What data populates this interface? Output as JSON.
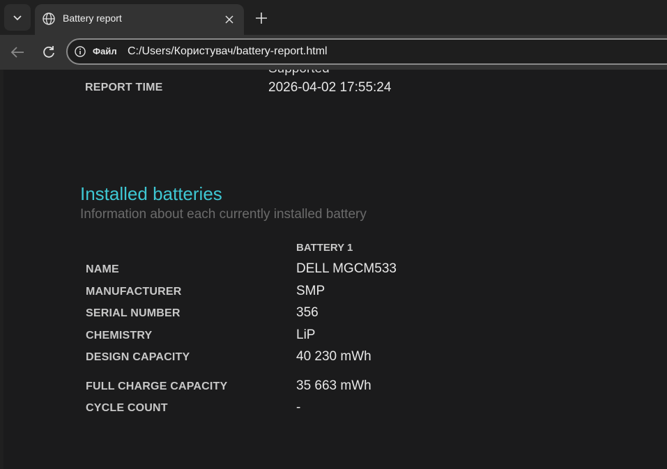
{
  "browser": {
    "tab_title": "Battery report",
    "scheme_label": "Файл",
    "url": "C:/Users/Користувач/battery-report.html"
  },
  "report": {
    "prev_value_cut": "Supported",
    "report_time_label": "REPORT TIME",
    "report_time_value": "2026-04-02  17:55:24"
  },
  "installed": {
    "title": "Installed batteries",
    "subtitle": "Information about each currently installed battery",
    "column_header": "BATTERY 1",
    "rows": [
      {
        "label": "NAME",
        "value": "DELL MGCM533"
      },
      {
        "label": "MANUFACTURER",
        "value": "SMP"
      },
      {
        "label": "SERIAL NUMBER",
        "value": "356"
      },
      {
        "label": "CHEMISTRY",
        "value": "LiP"
      },
      {
        "label": "DESIGN CAPACITY",
        "value": "40 230 mWh"
      },
      {
        "label": "FULL CHARGE CAPACITY",
        "value": "35 663 mWh"
      },
      {
        "label": "CYCLE COUNT",
        "value": "-"
      }
    ]
  }
}
